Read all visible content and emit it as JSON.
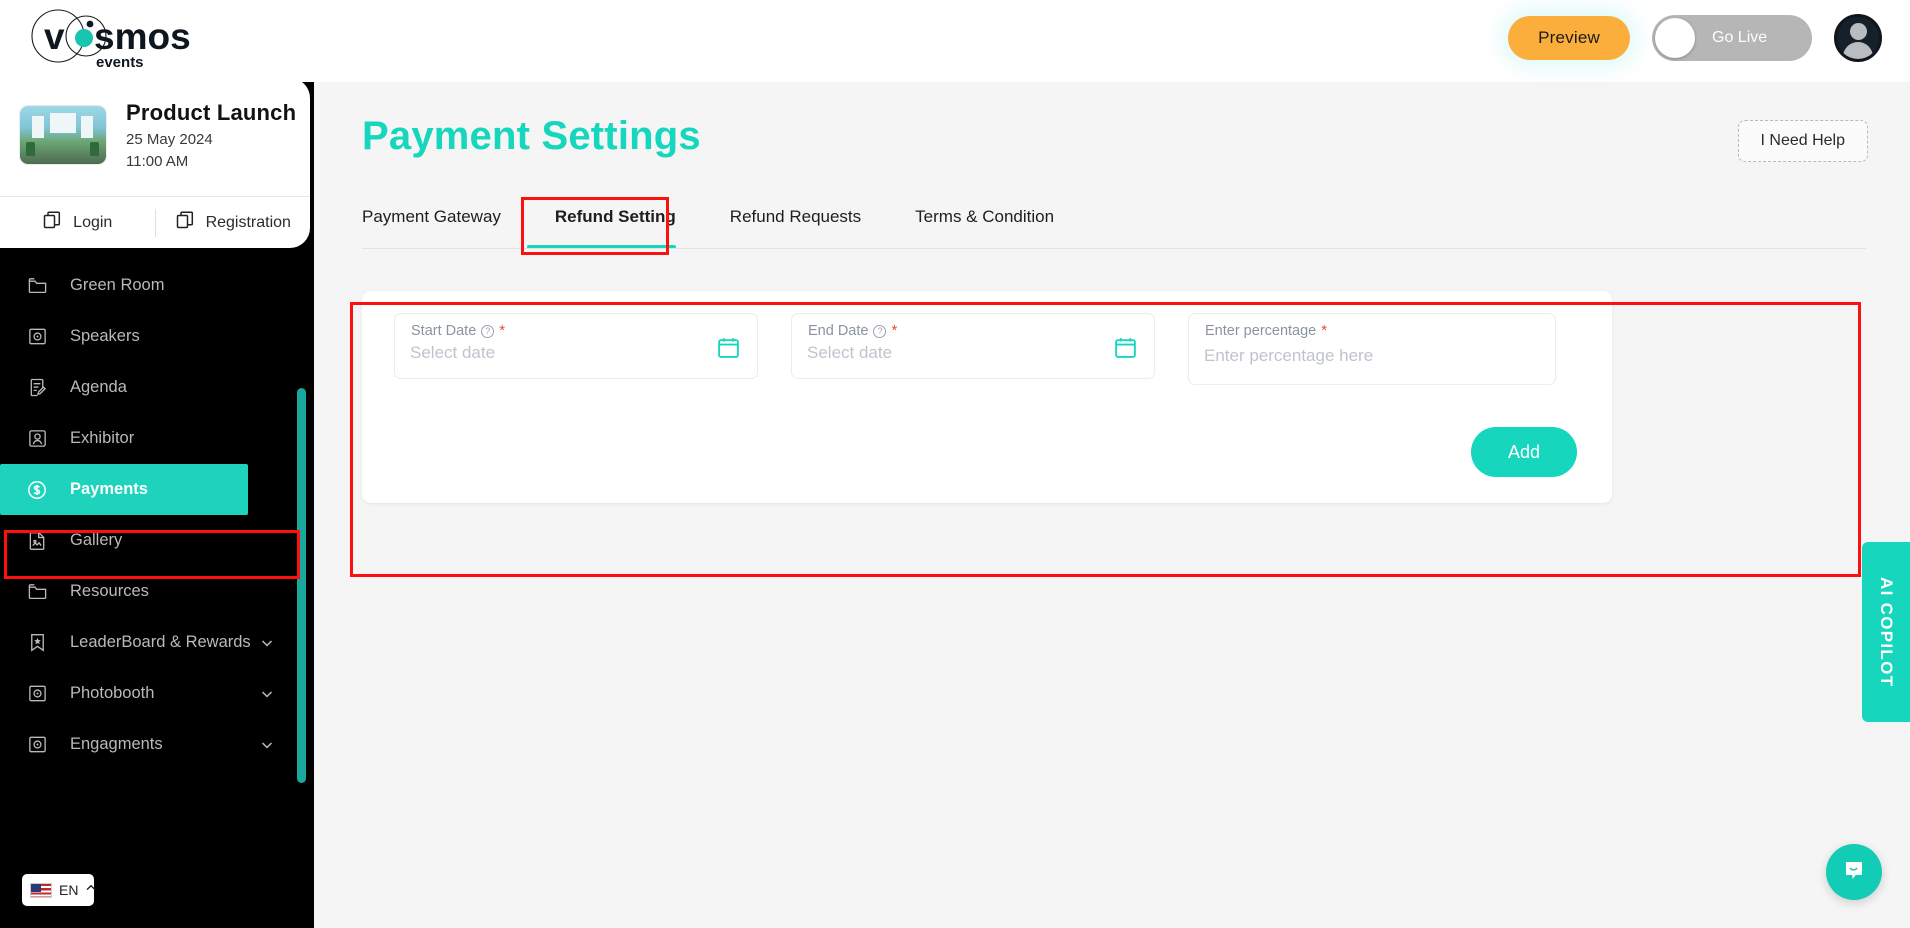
{
  "brand": {
    "name": "vosmos",
    "subtitle": "events",
    "accent_color": "#16d6bd"
  },
  "topbar": {
    "preview_label": "Preview",
    "go_live_label": "Go Live",
    "go_live_state": "off",
    "avatar_name": "account-avatar"
  },
  "event_card": {
    "title": "Product Launch",
    "date": "25 May 2024",
    "time": "11:00 AM",
    "actions": [
      {
        "label": "Login",
        "icon": "copy-icon"
      },
      {
        "label": "Registration",
        "icon": "copy-icon"
      }
    ]
  },
  "sidebar": {
    "items": [
      {
        "label": "Green Room",
        "icon": "folder-icon",
        "active": false,
        "chevron": false
      },
      {
        "label": "Speakers",
        "icon": "camera-icon",
        "active": false,
        "chevron": false
      },
      {
        "label": "Agenda",
        "icon": "agenda-icon",
        "active": false,
        "chevron": false
      },
      {
        "label": "Exhibitor",
        "icon": "person-icon",
        "active": false,
        "chevron": false
      },
      {
        "label": "Payments",
        "icon": "dollar-icon",
        "active": true,
        "chevron": false
      },
      {
        "label": "Gallery",
        "icon": "image-icon",
        "active": false,
        "chevron": false
      },
      {
        "label": "Resources",
        "icon": "folder-icon",
        "active": false,
        "chevron": false
      },
      {
        "label": "LeaderBoard & Rewards",
        "icon": "bookmark-icon",
        "active": false,
        "chevron": true
      },
      {
        "label": "Photobooth",
        "icon": "camera-icon",
        "active": false,
        "chevron": true
      },
      {
        "label": "Engagments",
        "icon": "camera-icon",
        "active": false,
        "chevron": true
      }
    ],
    "language": {
      "code": "EN",
      "flag": "us-flag-icon",
      "chevron": "chevron-up-icon"
    }
  },
  "main": {
    "page_title": "Payment Settings",
    "need_help_label": "I Need Help",
    "tabs": [
      {
        "label": "Payment Gateway",
        "active": false
      },
      {
        "label": "Refund Setting",
        "active": true
      },
      {
        "label": "Refund Requests",
        "active": false
      },
      {
        "label": "Terms & Condition",
        "active": false
      }
    ],
    "refund_form": {
      "start_date": {
        "label": "Start Date",
        "required_mark": "*",
        "help": "?",
        "value": "",
        "placeholder": "Select date"
      },
      "end_date": {
        "label": "End Date",
        "required_mark": "*",
        "help": "?",
        "value": "",
        "placeholder": "Select date"
      },
      "percentage": {
        "label": "Enter percentage",
        "required_mark": "*",
        "value": "",
        "placeholder": "Enter percentage here"
      },
      "add_label": "Add"
    }
  },
  "widgets": {
    "copilot_label": "AI COPILOT",
    "chat_icon": "chat-bubble-icon"
  },
  "annotations": {
    "highlight_color": "#fc1111",
    "boxes": [
      "refund-setting-tab",
      "refund-form-panel",
      "payments-nav-item"
    ]
  }
}
